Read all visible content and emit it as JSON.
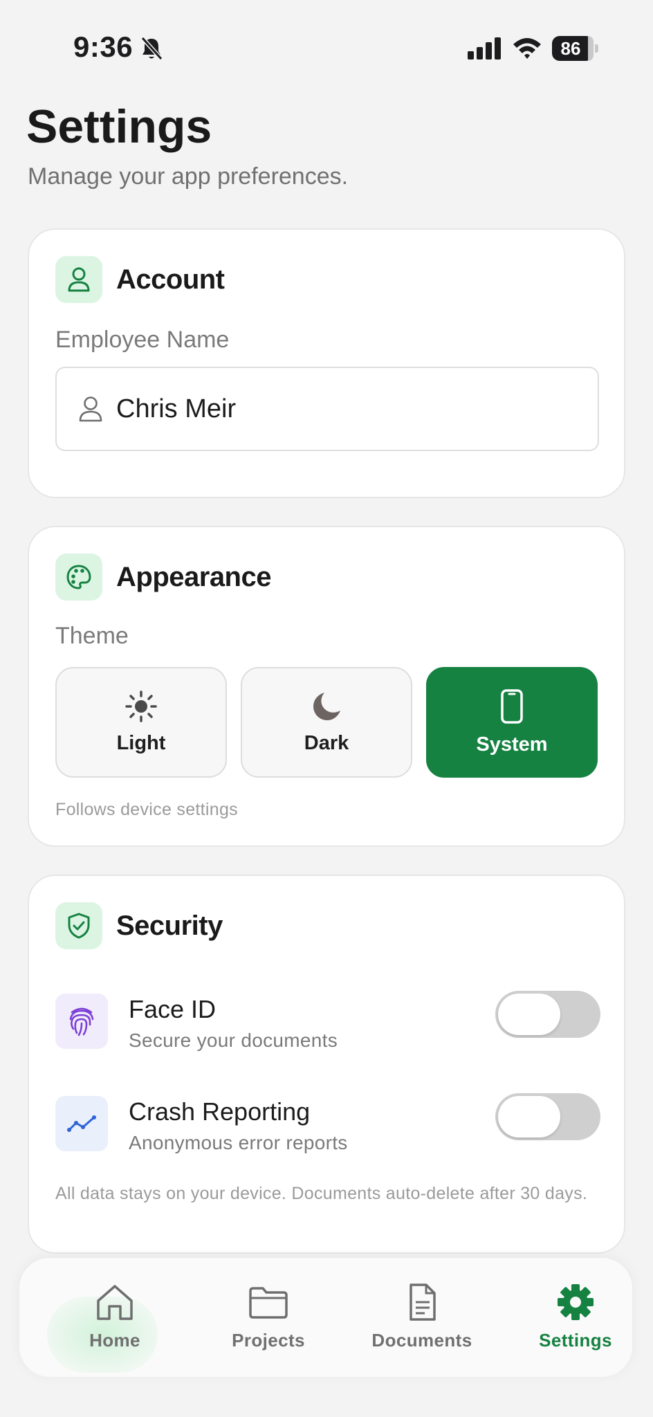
{
  "status_bar": {
    "time": "9:36",
    "battery_level": "86",
    "icons": [
      "bell-slash-icon",
      "signal-icon",
      "wifi-icon",
      "battery-icon"
    ]
  },
  "header": {
    "title": "Settings",
    "subtitle": "Manage your app preferences."
  },
  "account": {
    "title": "Account",
    "icon": "person-icon",
    "field_label": "Employee Name",
    "employee_name": "Chris Meir"
  },
  "appearance": {
    "title": "Appearance",
    "icon": "palette-icon",
    "theme_label": "Theme",
    "options": [
      {
        "label": "Light",
        "icon": "sun-icon",
        "selected": false
      },
      {
        "label": "Dark",
        "icon": "moon-icon",
        "selected": false
      },
      {
        "label": "System",
        "icon": "phone-icon",
        "selected": true
      }
    ],
    "hint": "Follows device settings"
  },
  "security": {
    "title": "Security",
    "icon": "shield-check-icon",
    "items": [
      {
        "title": "Face ID",
        "subtitle": "Secure your documents",
        "icon": "fingerprint-icon",
        "enabled": false
      },
      {
        "title": "Crash Reporting",
        "subtitle": "Anonymous error reports",
        "icon": "chart-line-icon",
        "enabled": false
      }
    ],
    "footnote": "All data stays on your device. Documents auto-delete after 30 days."
  },
  "tab_bar": {
    "tabs": [
      {
        "label": "Home",
        "icon": "home-icon",
        "active": false
      },
      {
        "label": "Projects",
        "icon": "folder-icon",
        "active": false
      },
      {
        "label": "Documents",
        "icon": "document-icon",
        "active": false
      },
      {
        "label": "Settings",
        "icon": "gear-icon",
        "active": true
      }
    ]
  },
  "colors": {
    "accent": "#168242",
    "accent_light": "#dcf5e3",
    "background": "#f3f3f3",
    "card": "#ffffff",
    "faceid_icon_bg": "#f1ecfb",
    "faceid_icon": "#7b3fd6",
    "crash_icon_bg": "#e9effb",
    "crash_icon": "#2f63d6"
  }
}
